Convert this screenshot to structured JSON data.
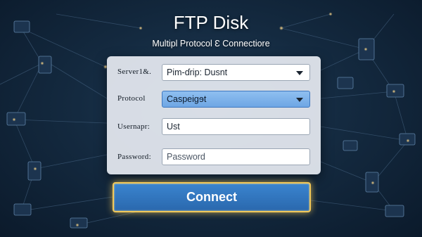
{
  "app": {
    "title": "FTP Disk",
    "subtitle": "Multipl Protocol Ɛ Connectiore"
  },
  "form": {
    "server": {
      "label": "Server1&.",
      "value": "Pim-ɗrip: Dusnt",
      "control": "dropdown"
    },
    "protocol": {
      "label": "Protocol",
      "value": "Caspeigɘt",
      "control": "dropdown",
      "highlighted": true
    },
    "username": {
      "label": "Usernapr:",
      "value": "Ust"
    },
    "password": {
      "label": "Password:",
      "placeholder": "Password"
    }
  },
  "actions": {
    "connect_label": "Connect"
  },
  "colors": {
    "background": "#142a40",
    "panel": "#ecf0f6",
    "button": "#2f74bd",
    "button_glow": "#f1c85a",
    "highlight_select": "#7fb2ea"
  }
}
